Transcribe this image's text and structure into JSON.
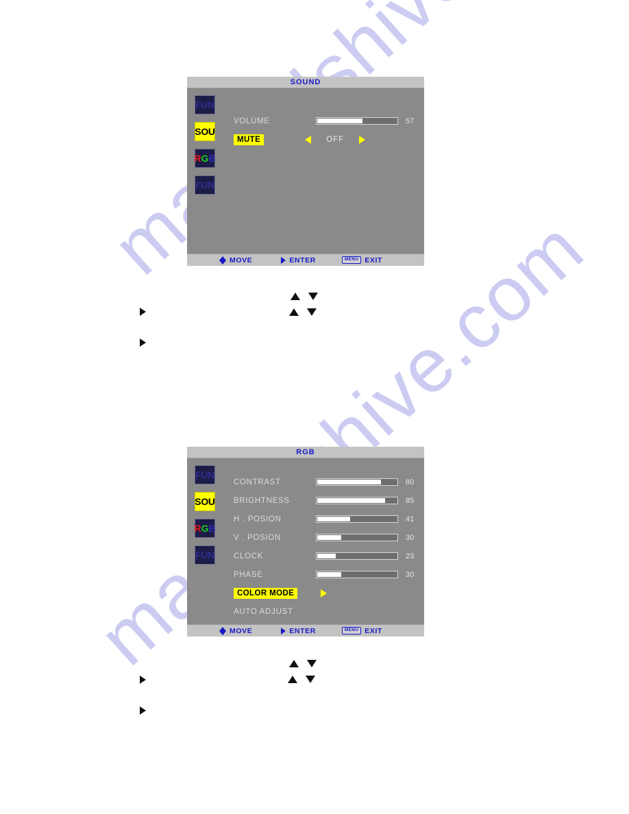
{
  "page": {
    "background": "#ffffff",
    "watermark_text": "manualshive.com",
    "watermark_color": "#ccccf2"
  },
  "colors": {
    "panel_body": "#8a8a8a",
    "panel_titlebar": "#c3c3c3",
    "title_text": "#1818c8",
    "highlight": "#ffff00",
    "bar_fill": "#ffffff",
    "icon_dim_bg": "#1c1c48"
  },
  "sidebar_icons": [
    {
      "label": "FUN",
      "state": "dim"
    },
    {
      "label": "SOU",
      "state": "active"
    },
    {
      "label": "RGB",
      "state": "rgb"
    },
    {
      "label": "FUN",
      "state": "dim"
    }
  ],
  "footer": {
    "move_label": "MOVE",
    "enter_label": "ENTER",
    "menu_label": "MENU",
    "exit_label": "EXIT"
  },
  "sound_panel": {
    "title": "SOUND",
    "rows": [
      {
        "label": "VOLUME",
        "type": "slider",
        "value": "57",
        "percent": 57
      },
      {
        "label": "MUTE",
        "type": "toggle",
        "value": "OFF",
        "highlighted": true
      }
    ]
  },
  "rgb_panel": {
    "title": "RGB",
    "rows": [
      {
        "label": "CONTRAST",
        "type": "slider",
        "value": "80",
        "percent": 80
      },
      {
        "label": "BRIGHTNESS",
        "type": "slider",
        "value": "85",
        "percent": 85
      },
      {
        "label": "H . POSION",
        "type": "slider",
        "value": "41",
        "percent": 41
      },
      {
        "label": "V . POSION",
        "type": "slider",
        "value": "30",
        "percent": 30
      },
      {
        "label": "CLOCK",
        "type": "slider",
        "value": "23",
        "percent": 23
      },
      {
        "label": "PHASE",
        "type": "slider",
        "value": "30",
        "percent": 30
      },
      {
        "label": "COLOR MODE",
        "type": "submenu",
        "highlighted": true
      },
      {
        "label": "AUTO ADJUST",
        "type": "action"
      }
    ]
  }
}
